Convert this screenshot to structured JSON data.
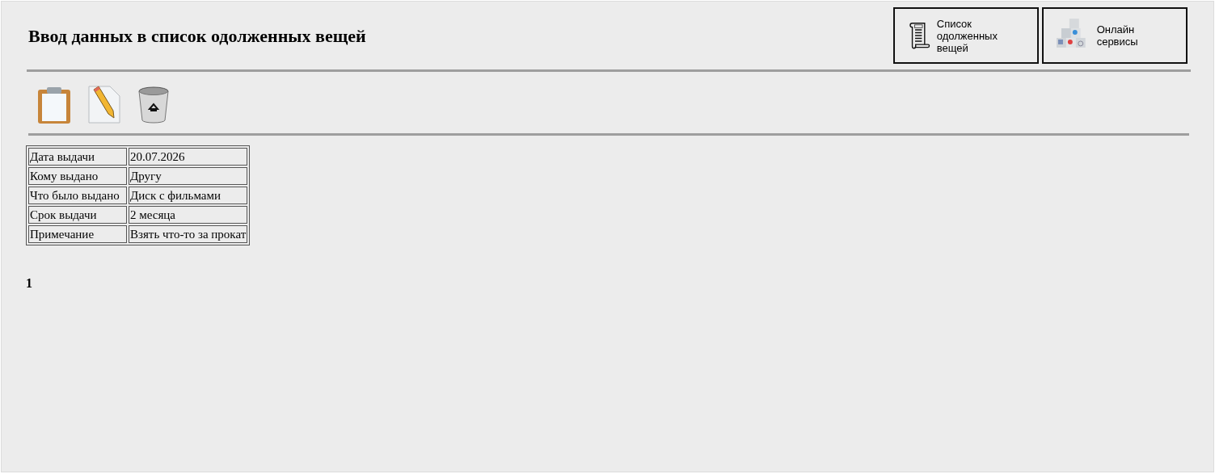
{
  "title": "Ввод данных в список одолженных вещей",
  "nav_buttons": [
    {
      "kind": "list",
      "label": "Список одолженных вещей"
    },
    {
      "kind": "services",
      "label": "Онлайн сервисы"
    }
  ],
  "toolbar": [
    {
      "kind": "clipboard"
    },
    {
      "kind": "edit"
    },
    {
      "kind": "trash"
    }
  ],
  "record": [
    {
      "field": "Дата выдачи",
      "value": "20.07.2026"
    },
    {
      "field": "Кому выдано",
      "value": "Другу"
    },
    {
      "field": "Что было выдано",
      "value": "Диск с фильмами"
    },
    {
      "field": "Срок выдачи",
      "value": "2 месяца"
    },
    {
      "field": "Примечание",
      "value": "Взять что-то за прокат"
    }
  ],
  "page_number": "1"
}
